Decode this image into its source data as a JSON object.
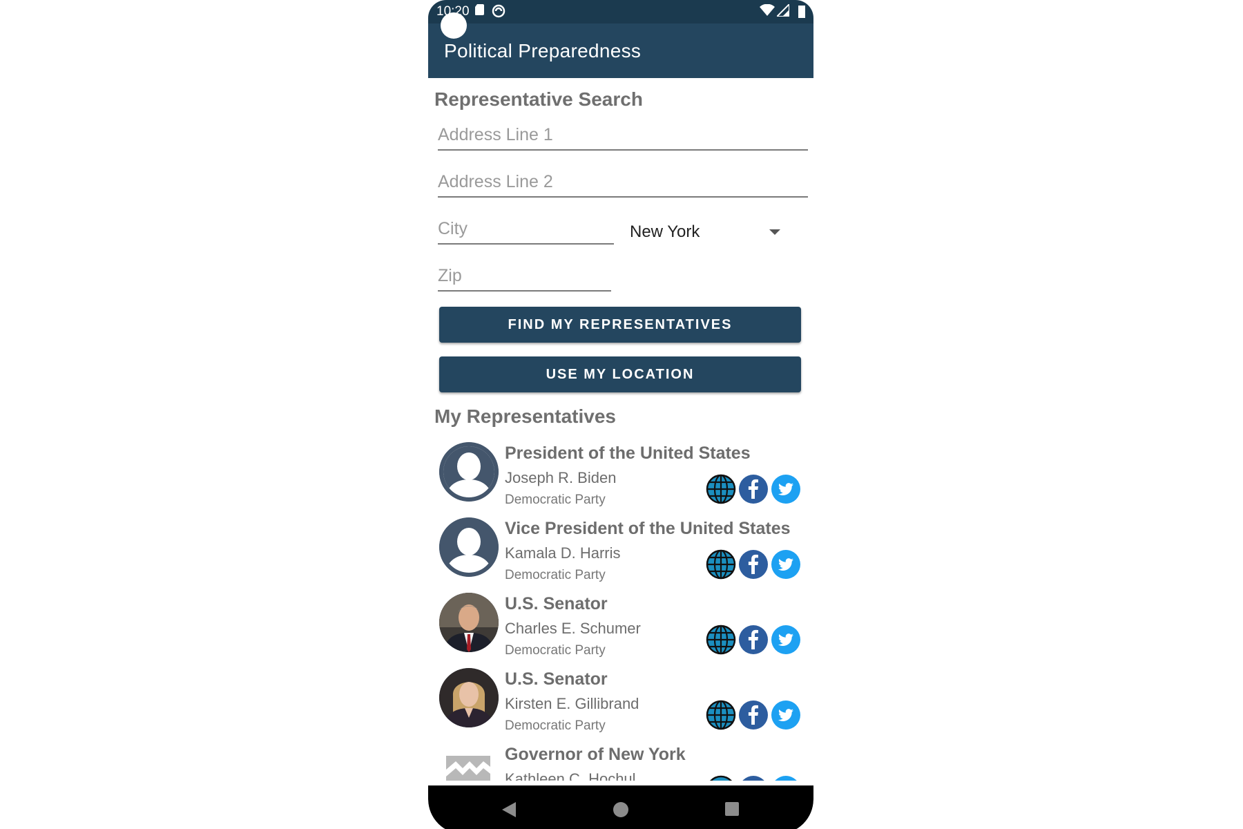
{
  "status_bar": {
    "time": "10:20"
  },
  "app_bar": {
    "title": "Political Preparedness"
  },
  "search": {
    "section_title": "Representative Search",
    "address1_placeholder": "Address Line 1",
    "address2_placeholder": "Address Line 2",
    "city_placeholder": "City",
    "state_value": "New York",
    "zip_placeholder": "Zip",
    "find_button": "FIND MY REPRESENTATIVES",
    "location_button": "USE MY LOCATION"
  },
  "representatives": {
    "section_title": "My Representatives",
    "items": [
      {
        "office": "President of the United States",
        "name": "Joseph R. Biden",
        "party": "Democratic Party",
        "avatar": "profile-placeholder-icon"
      },
      {
        "office": "Vice President of the United States",
        "name": "Kamala D. Harris",
        "party": "Democratic Party",
        "avatar": "profile-placeholder-icon"
      },
      {
        "office": "U.S. Senator",
        "name": "Charles E. Schumer",
        "party": "Democratic Party",
        "avatar": "photo"
      },
      {
        "office": "U.S. Senator",
        "name": "Kirsten E. Gillibrand",
        "party": "Democratic Party",
        "avatar": "photo"
      },
      {
        "office": "Governor of New York",
        "name": "Kathleen C. Hochul",
        "party": "",
        "avatar": "broken-image-icon"
      }
    ]
  },
  "colors": {
    "app_bar": "#24465f",
    "status_bar": "#1b3a4f",
    "button": "#24465f",
    "facebook": "#2d5d9f",
    "twitter": "#1da1f2",
    "globe": "#1b8fc0"
  }
}
